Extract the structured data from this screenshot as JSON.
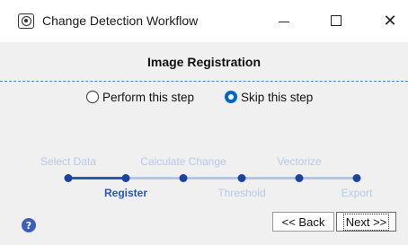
{
  "window": {
    "title": "Change Detection Workflow",
    "icon": "app-window-icon",
    "minimize_glyph": "—",
    "maximize_glyph": "☐",
    "close_glyph": "✕"
  },
  "header": {
    "step_title": "Image Registration"
  },
  "options": {
    "perform_label": "Perform this step",
    "skip_label": "Skip this step",
    "selected": "skip"
  },
  "stepper": {
    "top_labels": [
      "Select Data",
      "Calculate Change",
      "Vectorize"
    ],
    "bottom_labels": [
      "Register",
      "Threshold",
      "Export"
    ],
    "current_step": "Register",
    "progress_fraction": 0.2
  },
  "footer": {
    "help_glyph": "?",
    "back_label": "<< Back",
    "next_label": "Next >>"
  },
  "colors": {
    "accent": "#0067c0",
    "step_current": "#2857b6",
    "step_inactive": "#b7c9e8",
    "dash": "#4a7fc8"
  }
}
